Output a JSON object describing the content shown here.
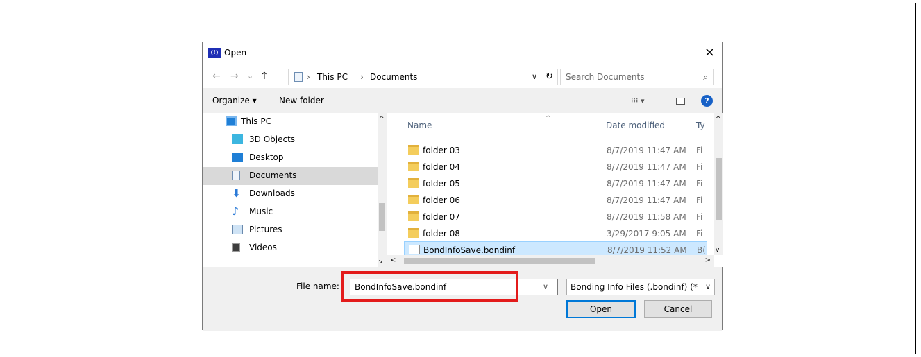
{
  "dialog": {
    "title": "Open",
    "app_icon": "(!)"
  },
  "nav": {
    "back_icon": "←",
    "forward_icon": "→",
    "recent_icon": "⌄",
    "up_icon": "↑",
    "breadcrumb": [
      "This PC",
      "Documents"
    ],
    "separator": "›",
    "address_dropdown": "∨",
    "refresh_icon": "↻",
    "search_placeholder": "Search Documents",
    "search_icon": "⌕"
  },
  "toolbar": {
    "organize_label": "Organize ▾",
    "new_folder_label": "New folder",
    "view_icon": "⁞⁞⁞ ▾",
    "help_icon": "?"
  },
  "navpane": {
    "items": [
      {
        "label": "This PC",
        "icon": "monitor-icon"
      },
      {
        "label": "3D Objects",
        "icon": "cube-icon"
      },
      {
        "label": "Desktop",
        "icon": "desktop-icon"
      },
      {
        "label": "Documents",
        "icon": "documents-icon",
        "selected": true
      },
      {
        "label": "Downloads",
        "icon": "download-arrow-icon"
      },
      {
        "label": "Music",
        "icon": "music-note-icon"
      },
      {
        "label": "Pictures",
        "icon": "pictures-icon"
      },
      {
        "label": "Videos",
        "icon": "film-icon"
      }
    ]
  },
  "filelist": {
    "columns": {
      "name": "Name",
      "date": "Date modified",
      "type": "Ty"
    },
    "rows": [
      {
        "name": "folder 03",
        "date": "8/7/2019 11:47 AM",
        "type": "Fi"
      },
      {
        "name": "folder 04",
        "date": "8/7/2019 11:47 AM",
        "type": "Fi"
      },
      {
        "name": "folder 05",
        "date": "8/7/2019 11:47 AM",
        "type": "Fi"
      },
      {
        "name": "folder 06",
        "date": "8/7/2019 11:47 AM",
        "type": "Fi"
      },
      {
        "name": "folder 07",
        "date": "8/7/2019 11:58 AM",
        "type": "Fi"
      },
      {
        "name": "folder 08",
        "date": "3/29/2017 9:05 AM",
        "type": "Fi"
      },
      {
        "name": "BondInfoSave.bondinf",
        "date": "8/7/2019 11:52 AM",
        "type": "B(",
        "selected": true,
        "file": true
      }
    ]
  },
  "bottom": {
    "filename_label": "File name:",
    "filename_value": "BondInfoSave.bondinf",
    "filter_value": "Bonding Info Files (.bondinf) (*",
    "open_label": "Open",
    "cancel_label": "Cancel"
  },
  "colors": {
    "highlight": "#e31b1b",
    "selection": "#cce8ff",
    "accent": "#0078d7"
  }
}
